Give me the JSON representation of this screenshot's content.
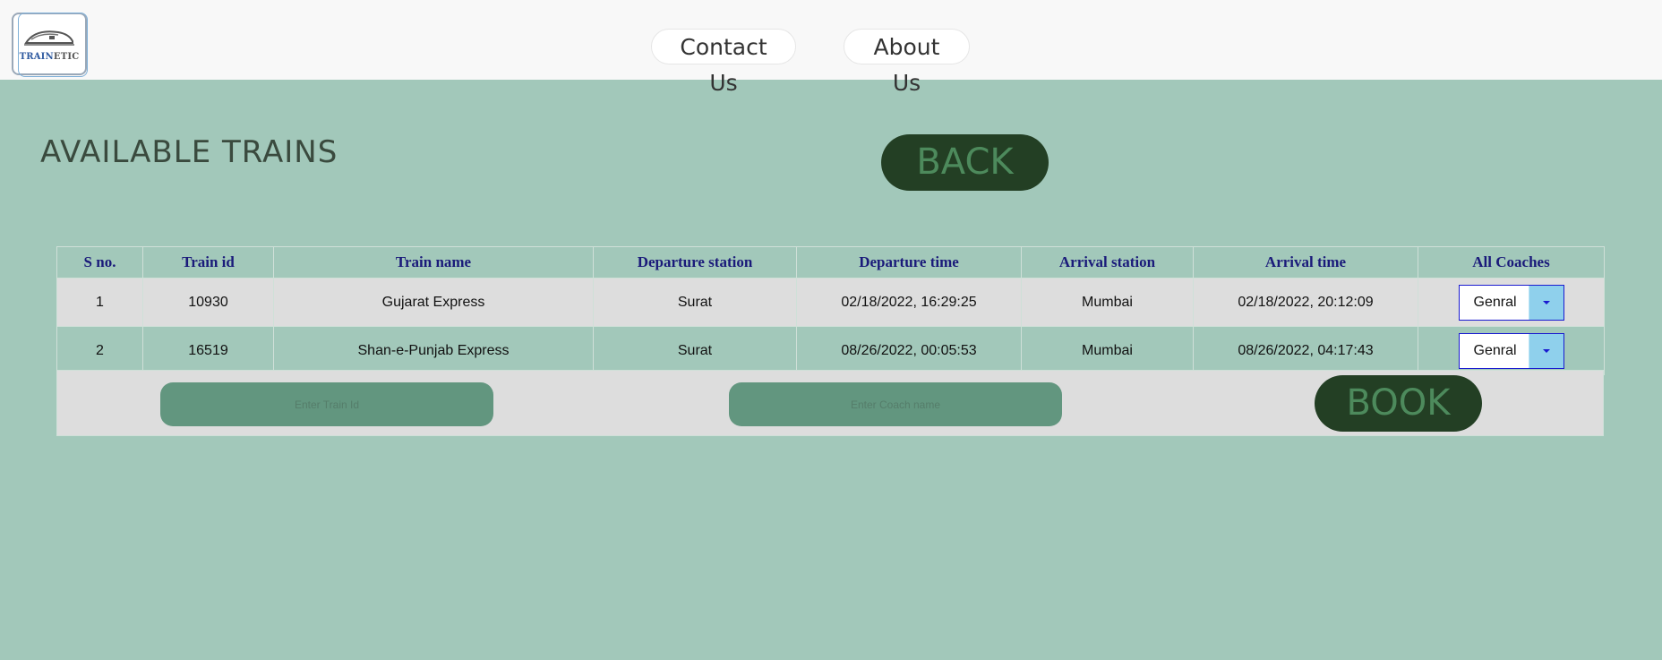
{
  "brand": {
    "logo_text_a": "TRAIN",
    "logo_text_b": "ETIC"
  },
  "nav": {
    "contact": "Contact Us",
    "about": "About Us"
  },
  "page": {
    "title": "AVAILABLE TRAINS",
    "back_label": "BACK"
  },
  "table": {
    "headers": [
      "S no.",
      "Train id",
      "Train name",
      "Departure station",
      "Departure time",
      "Arrival station",
      "Arrival time",
      "All Coaches"
    ],
    "rows": [
      {
        "sno": "1",
        "train_id": "10930",
        "train_name": "Gujarat Express",
        "dep_station": "Surat",
        "dep_time": "02/18/2022, 16:29:25",
        "arr_station": "Mumbai",
        "arr_time": "02/18/2022, 20:12:09",
        "coach": "Genral"
      },
      {
        "sno": "2",
        "train_id": "16519",
        "train_name": "Shan-e-Punjab Express",
        "dep_station": "Surat",
        "dep_time": "08/26/2022, 00:05:53",
        "arr_station": "Mumbai",
        "arr_time": "08/26/2022, 04:17:43",
        "coach": "Genral"
      }
    ]
  },
  "booking": {
    "train_id_placeholder": "Enter Train Id",
    "coach_placeholder": "Enter Coach name",
    "book_label": "BOOK"
  },
  "colors": {
    "background": "#a2c8ba",
    "button_bg": "#233f24",
    "button_text": "#4d8a5c",
    "header_text": "#1a1a7a",
    "input_bg": "#62967f"
  }
}
